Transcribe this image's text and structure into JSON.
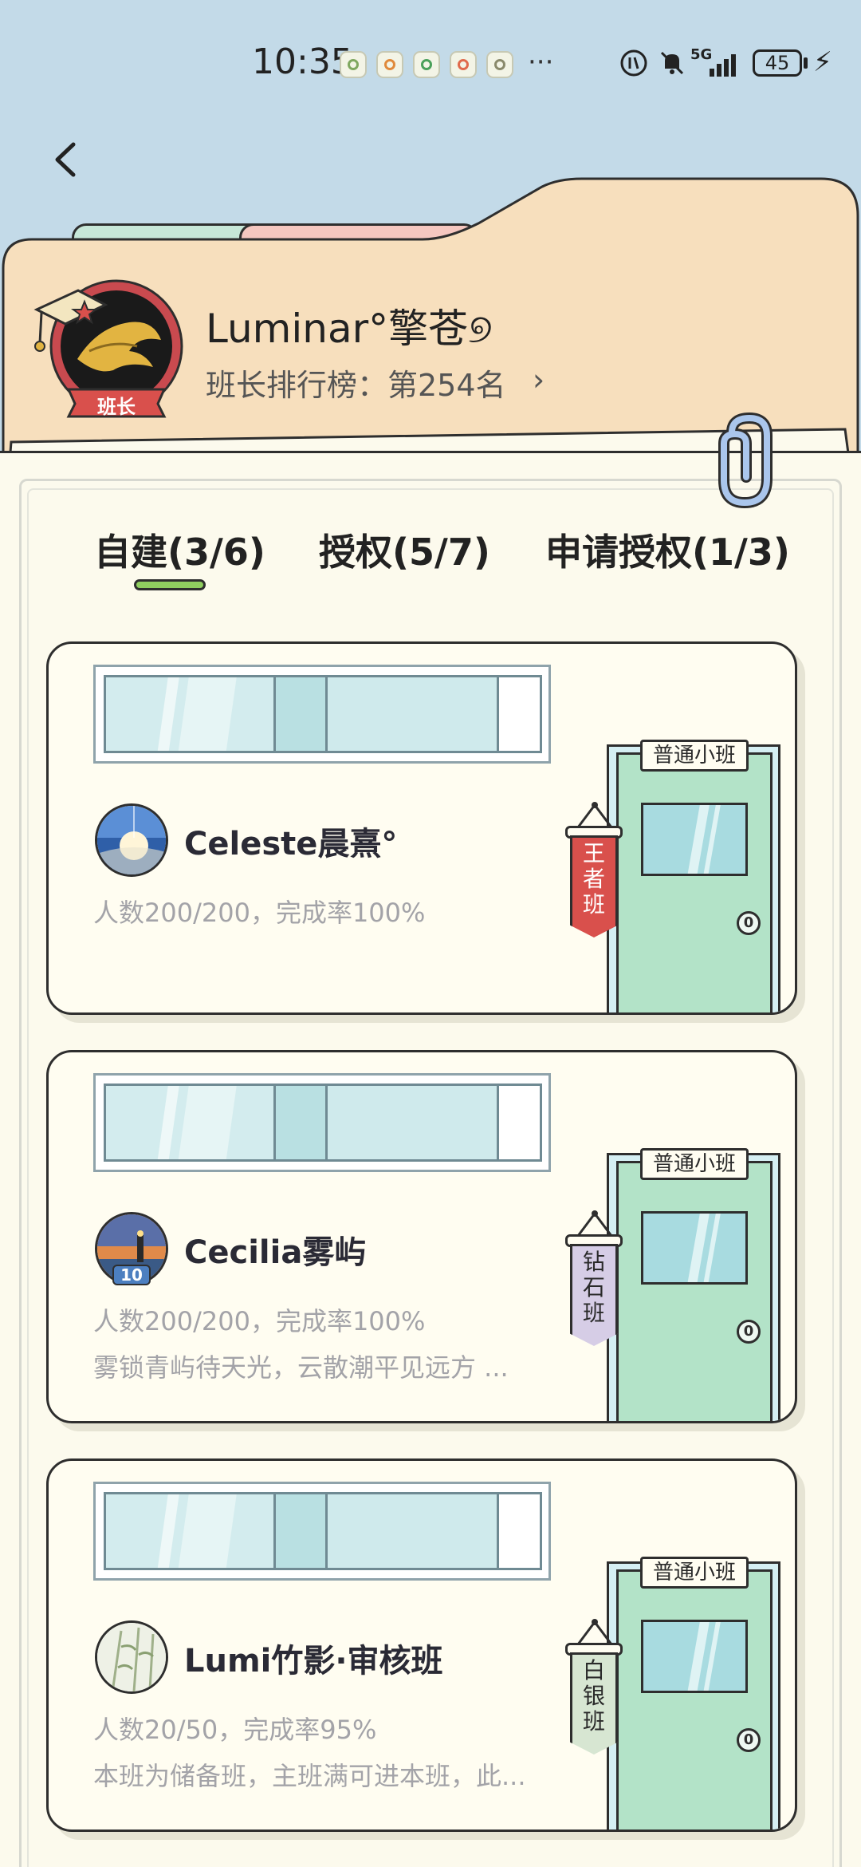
{
  "status_bar": {
    "time": "10:35",
    "more": "···",
    "battery": "45"
  },
  "header": {
    "back_icon": "chevron-left-icon",
    "badge_label": "班长",
    "username": "Luminar°擎苍୭",
    "rank_text": "班长排行榜：第254名",
    "rank_arrow": "›"
  },
  "tabs": [
    {
      "label": "自建(3/6)",
      "active": true
    },
    {
      "label": "授权(5/7)",
      "active": false
    },
    {
      "label": "申请授权(1/3)",
      "active": false
    }
  ],
  "classes": [
    {
      "name": "Celeste晨熹°",
      "stats": "人数200/200，完成率100%",
      "description": "",
      "door_sign": "普通小班",
      "knob": "0",
      "banner": [
        "王",
        "者",
        "班"
      ],
      "banner_color": "#d9504c",
      "banner_text_color": "#ffffff"
    },
    {
      "name": "Cecilia雾屿",
      "stats": "人数200/200，完成率100%",
      "description": "雾锁青屿待天光，云散潮平见远方 ...",
      "avatar_badge": "10",
      "door_sign": "普通小班",
      "knob": "0",
      "banner": [
        "钻",
        "石",
        "班"
      ],
      "banner_color": "#d6cde6",
      "banner_text_color": "#2a2a2a"
    },
    {
      "name": "Lumi竹影·审核班",
      "stats": "人数20/50，完成率95%",
      "description": "本班为储备班，主班满可进本班，此...",
      "door_sign": "普通小班",
      "knob": "0",
      "banner": [
        "白",
        "银",
        "班"
      ],
      "banner_color": "#d7e6d2",
      "banner_text_color": "#2a2a2a"
    }
  ],
  "colors": {
    "background": "#c3dae8",
    "folder": "#f7dfbd",
    "paper": "#fcfaed",
    "tab_indicator": "#8fce5f",
    "door": "#b3e3c8"
  }
}
